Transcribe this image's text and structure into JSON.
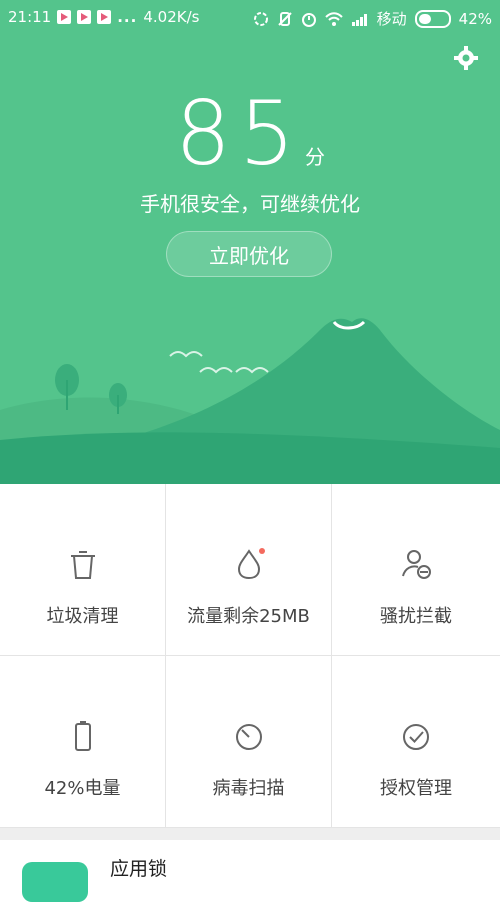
{
  "status_bar": {
    "time": "21:11",
    "dots": "...",
    "speed": "4.02K/s",
    "carrier": "移动",
    "battery": "42%",
    "icons": [
      "play-icon",
      "play-icon",
      "play-icon",
      "sync-icon",
      "mute-icon",
      "alarm-icon",
      "wifi-icon",
      "signal-icon",
      "battery-icon"
    ]
  },
  "hero": {
    "score": "85",
    "score_unit": "分",
    "subtitle": "手机很安全，可继续优化",
    "cta_label": "立即优化",
    "bg_color": "#54c48c"
  },
  "tools": [
    {
      "label": "垃圾清理",
      "icon": "trash-icon"
    },
    {
      "label": "流量剩余25MB",
      "icon": "data-drop-icon"
    },
    {
      "label": "骚扰拦截",
      "icon": "block-user-icon"
    },
    {
      "label": "42%电量",
      "icon": "battery-level-icon"
    },
    {
      "label": "病毒扫描",
      "icon": "virus-scan-icon"
    },
    {
      "label": "授权管理",
      "icon": "permission-check-icon"
    }
  ],
  "app_lock": {
    "label": "应用锁",
    "icon": "app-lock-icon"
  }
}
